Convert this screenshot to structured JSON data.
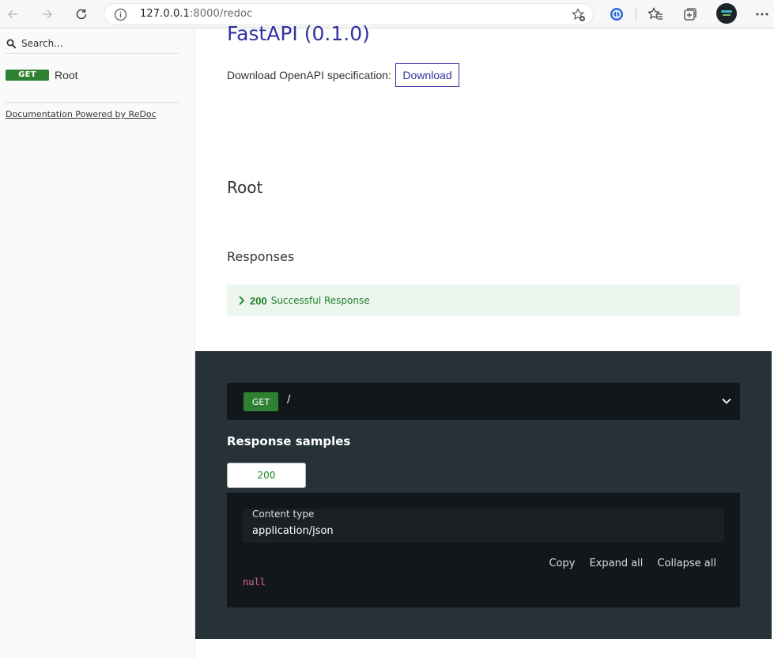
{
  "browser": {
    "url_host": "127.0.0.1",
    "url_rest": ":8000/redoc"
  },
  "sidebar": {
    "search_placeholder": "Search...",
    "items": [
      {
        "method": "GET",
        "label": "Root"
      }
    ],
    "powered_by": "Documentation Powered by ReDoc"
  },
  "main": {
    "title": "FastAPI (0.1.0)",
    "download_text": "Download OpenAPI specification:",
    "download_button": "Download",
    "operation_title": "Root",
    "responses_title": "Responses",
    "response": {
      "code": "200",
      "description": "Successful Response"
    }
  },
  "panel": {
    "method": "GET",
    "path": "/",
    "samples_title": "Response samples",
    "tab_label": "200",
    "content_type_label": "Content type",
    "content_type_value": "application/json",
    "actions": {
      "copy": "Copy",
      "expand": "Expand all",
      "collapse": "Collapse all"
    },
    "sample_value": "null"
  },
  "colors": {
    "get_green": "#2f8132",
    "title_blue": "#32329f",
    "dark_panel": "#263238"
  }
}
